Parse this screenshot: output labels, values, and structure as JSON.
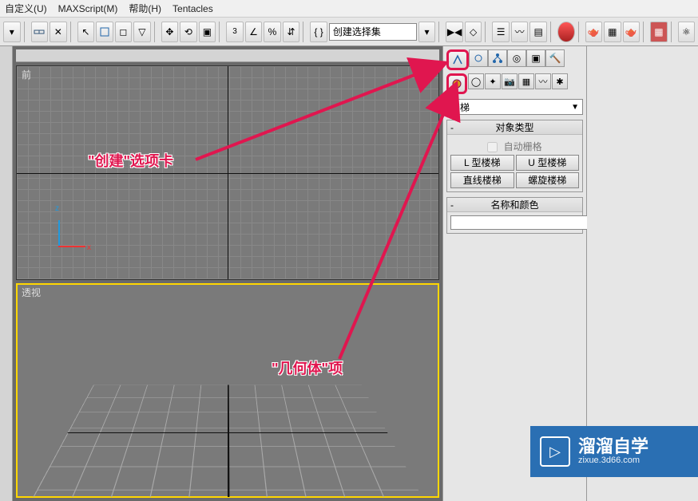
{
  "menu": {
    "customize": "自定义(U)",
    "maxscript": "MAXScript(M)",
    "help": "帮助(H)",
    "tentacles": "Tentacles"
  },
  "toolbar": {
    "selection_set": "创建选择集"
  },
  "viewports": {
    "front": "前",
    "persp": "透视",
    "axis_x": "x",
    "axis_z": "z"
  },
  "panel": {
    "tabs": [
      "create",
      "modify",
      "hierarchy",
      "motion",
      "display",
      "utilities"
    ],
    "dropdown_selected": "楼梯",
    "rollout_objtype": "对象类型",
    "autogrid": "自动栅格",
    "buttons": {
      "l_stair": "L 型楼梯",
      "u_stair": "U 型楼梯",
      "straight": "直线楼梯",
      "spiral": "螺旋楼梯"
    },
    "rollout_namecolor": "名称和颜色"
  },
  "callouts": {
    "create_tab": "\"创建\"选项卡",
    "geometry": "\"几何体\"项"
  },
  "watermark": {
    "title": "溜溜自学",
    "sub": "zixue.3d66.com"
  }
}
